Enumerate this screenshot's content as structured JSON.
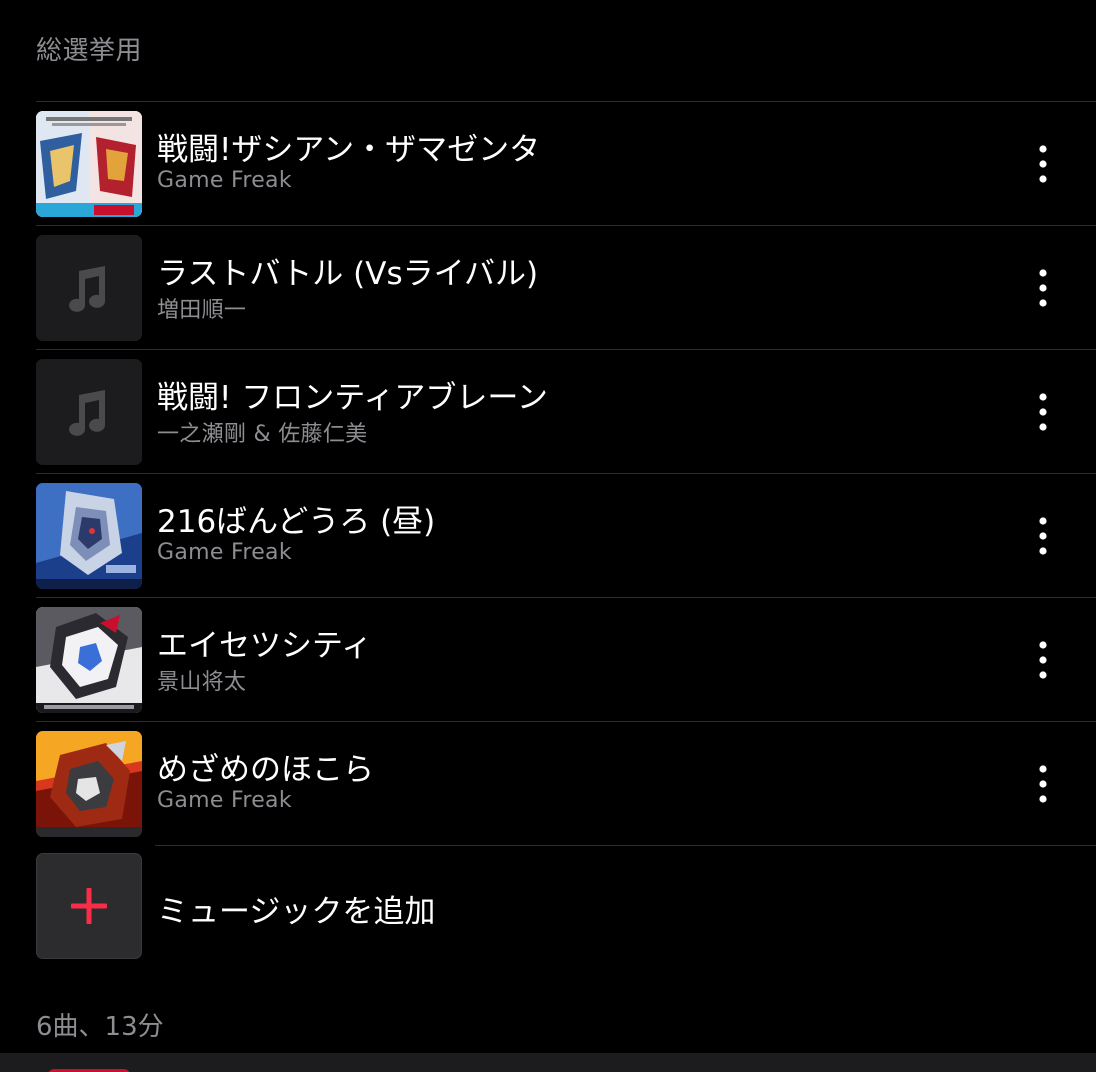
{
  "playlist": {
    "description": "総選挙用",
    "tracks": [
      {
        "title": "戦闘!ザシアン・ザマゼンタ",
        "artist": "Game Freak",
        "artwork": "sword-shield-art"
      },
      {
        "title": "ラストバトル (Vsライバル)",
        "artist": "増田順一",
        "artwork": "music-note-placeholder"
      },
      {
        "title": "戦闘! フロンティアブレーン",
        "artist": "一之瀬剛 & 佐藤仁美",
        "artwork": "music-note-placeholder"
      },
      {
        "title": "216ばんどうろ (昼)",
        "artist": "Game Freak",
        "artwork": "diamond-pearl-art"
      },
      {
        "title": "エイセツシティ",
        "artist": "景山将太",
        "artwork": "x-y-art"
      },
      {
        "title": "めざめのほこら",
        "artist": "Game Freak",
        "artwork": "ruby-sapphire-art"
      }
    ],
    "add_music_label": "ミュージックを追加",
    "summary": "6曲、13分"
  },
  "icons": {
    "more": "more-vertical-icon",
    "add": "plus-icon",
    "placeholder": "music-note-icon"
  },
  "colors": {
    "background": "#000000",
    "accent": "#fa2d48",
    "secondary_text": "#8d8d92",
    "separator": "#2c2c2e"
  }
}
